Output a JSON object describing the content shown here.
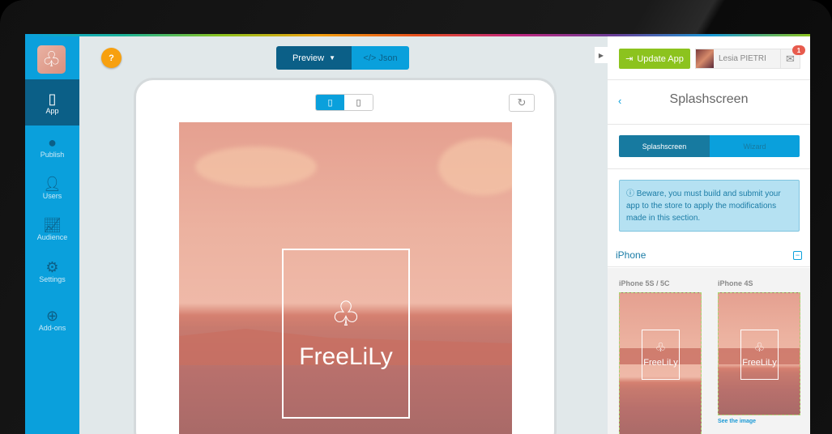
{
  "sidebar": {
    "logo_icon": "club-icon",
    "items": [
      {
        "label": "App",
        "icon": "phone-icon",
        "active": true
      },
      {
        "label": "Publish",
        "icon": "globe-icon"
      },
      {
        "label": "Users",
        "icon": "user-icon"
      },
      {
        "label": "Audience",
        "icon": "chart-icon"
      },
      {
        "label": "Settings",
        "icon": "gear-icon"
      },
      {
        "label": "Add-ons",
        "icon": "plus-circle-icon"
      }
    ]
  },
  "toolbar": {
    "help_label": "?",
    "preview_label": "Preview",
    "json_label": "</> Json"
  },
  "preview": {
    "brand_first": "Free",
    "brand_second": "LiLy",
    "refresh_icon": "↻"
  },
  "panel": {
    "update_label": "Update App",
    "user_name": "Lesia PIETRI",
    "notification_count": "1",
    "back_label": "‹",
    "title": "Splashscreen",
    "tabs": [
      "Splashscreen",
      "Wizard"
    ],
    "alert": "Beware, you must build and submit your app to the store to apply the modifications made in this section.",
    "section": "iPhone",
    "thumbs": [
      {
        "label": "iPhone 5S / 5C"
      },
      {
        "label": "iPhone 4S",
        "link": "See the image"
      }
    ]
  },
  "colors": {
    "primary": "#0aa0dc",
    "dark": "#0b5f87",
    "green": "#8cc31e",
    "orange": "#f7a00f"
  }
}
